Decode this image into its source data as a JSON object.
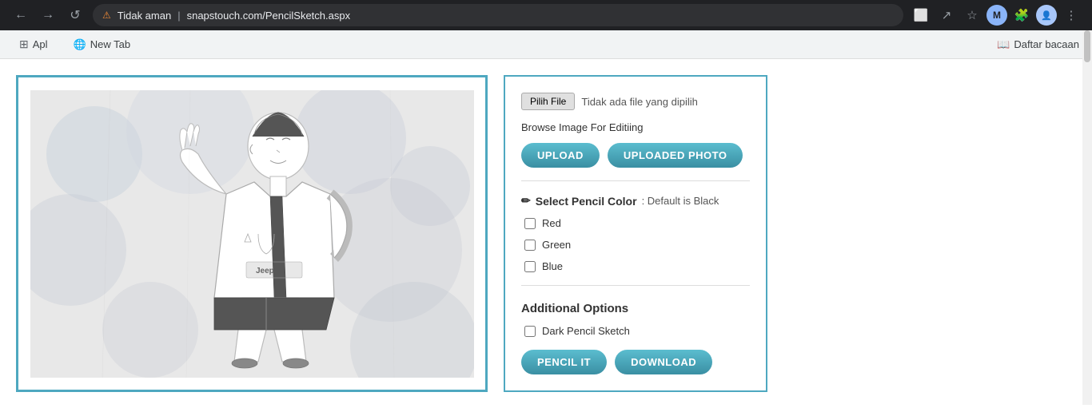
{
  "browser": {
    "back_label": "←",
    "forward_label": "→",
    "reload_label": "↺",
    "warning_text": "Tidak aman",
    "url": "snapstouch.com/PencilSketch.aspx",
    "translate_icon": "⬜",
    "share_icon": "↗",
    "bookmark_icon": "☆",
    "extension_icon": "🧩",
    "menu_icon": "⋮"
  },
  "bookmarks": {
    "apps_label": "Apl",
    "newtab_label": "New Tab",
    "reading_label": "Daftar bacaan"
  },
  "options_panel": {
    "file_btn_label": "Pilih File",
    "file_name": "Tidak ada file yang dipilih",
    "browse_label": "Browse Image For Editiing",
    "upload_btn": "UPLOAD",
    "uploaded_btn": "UPLOADED PHOTO",
    "pencil_color_title": "Select Pencil Color",
    "pencil_color_subtitle": ": Default is Black",
    "pencil_icon": "✏",
    "color_options": [
      {
        "id": "red",
        "label": "Red",
        "checked": false
      },
      {
        "id": "green",
        "label": "Green",
        "checked": false
      },
      {
        "id": "blue",
        "label": "Blue",
        "checked": false
      }
    ],
    "additional_options_title": "Additional Options",
    "dark_pencil_label": "Dark Pencil Sketch",
    "dark_pencil_checked": false,
    "pencil_it_btn": "PENCIL IT",
    "download_btn": "DOWNLOAD"
  }
}
